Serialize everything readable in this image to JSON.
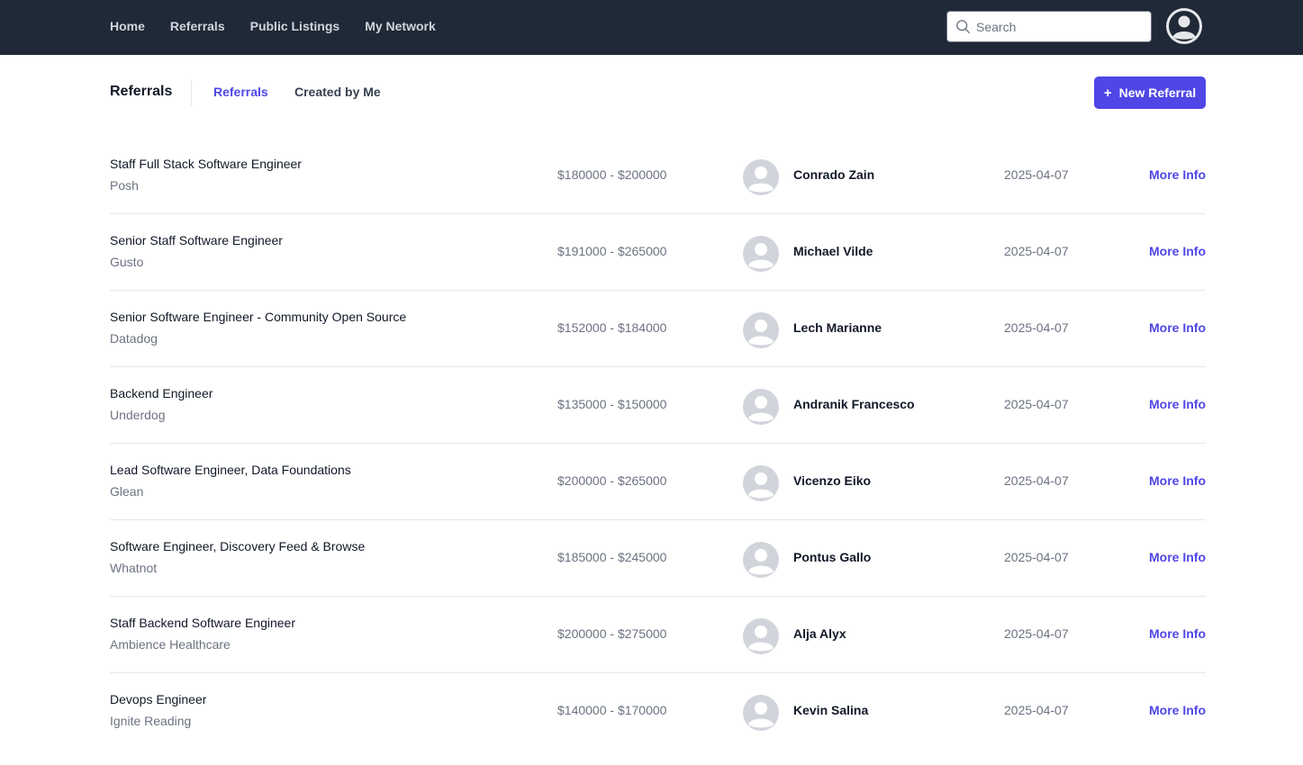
{
  "nav": {
    "items": [
      {
        "label": "Home"
      },
      {
        "label": "Referrals"
      },
      {
        "label": "Public Listings"
      },
      {
        "label": "My Network"
      }
    ],
    "search_placeholder": "Search",
    "search_icon": "search-icon",
    "avatar_icon": "user-circle-icon"
  },
  "page": {
    "title": "Referrals",
    "tabs": [
      {
        "label": "Referrals",
        "active": true
      },
      {
        "label": "Created by Me",
        "active": false
      }
    ],
    "new_button": {
      "icon": "+",
      "label": "New Referral"
    }
  },
  "colors": {
    "topbar": "#1f2937",
    "accent": "#4f46e5",
    "muted_text": "#6b7280"
  },
  "referrals": [
    {
      "title": "Staff Full Stack Software Engineer",
      "company": "Posh",
      "salary": "$180000 - $200000",
      "name": "Conrado Zain",
      "date": "2025-04-07",
      "action": "More Info"
    },
    {
      "title": "Senior Staff Software Engineer",
      "company": "Gusto",
      "salary": "$191000 - $265000",
      "name": "Michael Vilde",
      "date": "2025-04-07",
      "action": "More Info"
    },
    {
      "title": "Senior Software Engineer - Community Open Source",
      "company": "Datadog",
      "salary": "$152000 - $184000",
      "name": "Lech Marianne",
      "date": "2025-04-07",
      "action": "More Info"
    },
    {
      "title": "Backend Engineer",
      "company": "Underdog",
      "salary": "$135000 - $150000",
      "name": "Andranik Francesco",
      "date": "2025-04-07",
      "action": "More Info"
    },
    {
      "title": "Lead Software Engineer, Data Foundations",
      "company": "Glean",
      "salary": "$200000 - $265000",
      "name": "Vicenzo Eiko",
      "date": "2025-04-07",
      "action": "More Info"
    },
    {
      "title": "Software Engineer, Discovery Feed & Browse",
      "company": "Whatnot",
      "salary": "$185000 - $245000",
      "name": "Pontus Gallo",
      "date": "2025-04-07",
      "action": "More Info"
    },
    {
      "title": "Staff Backend Software Engineer",
      "company": "Ambience Healthcare",
      "salary": "$200000 - $275000",
      "name": "Alja Alyx",
      "date": "2025-04-07",
      "action": "More Info"
    },
    {
      "title": "Devops Engineer",
      "company": "Ignite Reading",
      "salary": "$140000 - $170000",
      "name": "Kevin Salina",
      "date": "2025-04-07",
      "action": "More Info"
    }
  ]
}
